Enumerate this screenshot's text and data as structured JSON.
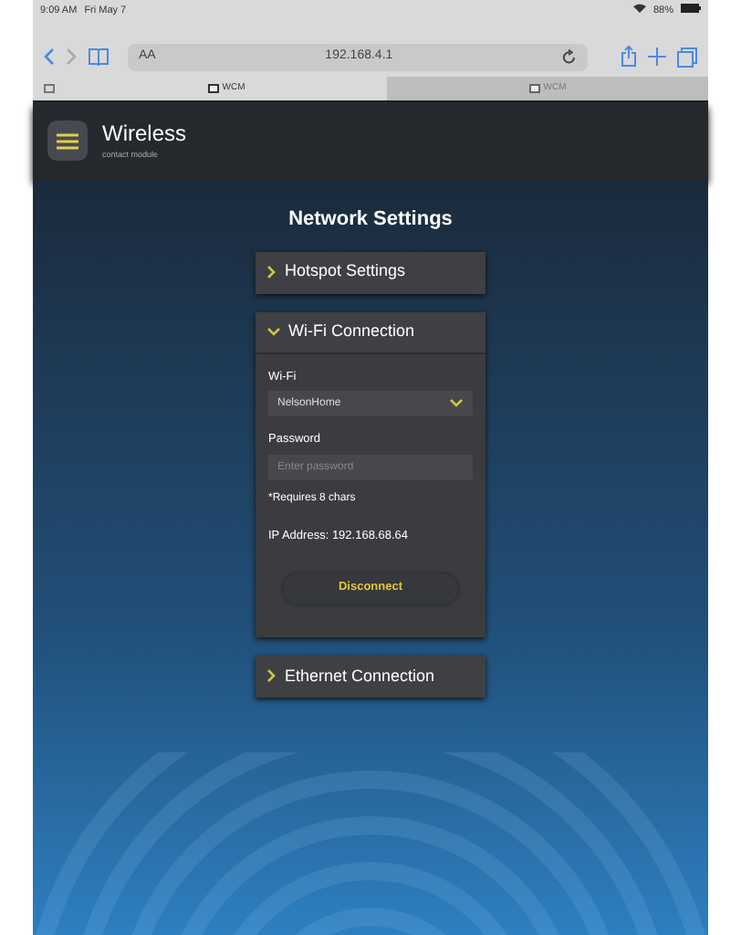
{
  "status_bar": {
    "time": "9:09 AM",
    "date": "Fri May 7",
    "battery": "88%"
  },
  "browser": {
    "text_size": "AA",
    "url": "192.168.4.1",
    "tabs": [
      {
        "label": "WCM",
        "selected": true
      },
      {
        "label": "WCM",
        "selected": false
      }
    ]
  },
  "app_header": {
    "logo_title": "Wireless",
    "logo_subtitle": "contact module"
  },
  "page_title": "Network Settings",
  "sections": [
    {
      "title": "Hotspot Settings",
      "expanded": false
    },
    {
      "title": "Wi-Fi Connection",
      "expanded": true,
      "wifi_label": "Wi-Fi",
      "wifi_value": "NelsonHome",
      "password_label": "Password",
      "password_placeholder": "Enter password",
      "hint": "*Requires 8 chars",
      "ip_label": "IP Address:",
      "ip_value": "192.168.68.64",
      "button": "Disconnect"
    },
    {
      "title": "Ethernet Connection",
      "expanded": false
    }
  ]
}
